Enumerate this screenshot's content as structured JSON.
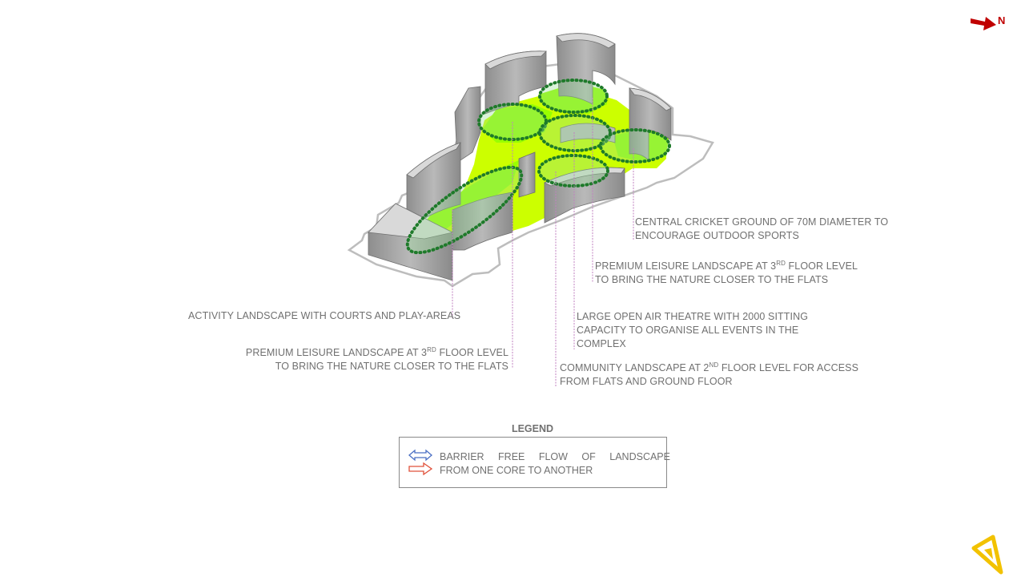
{
  "north": {
    "label": "N",
    "icon": "north-arrow-icon",
    "color": "#c00000"
  },
  "callouts": {
    "cricket_1": "CENTRAL CRICKET GROUND OF 70M DIAMETER TO",
    "cricket_2": "ENCOURAGE OUTDOOR SPORTS",
    "premium_right_1a": "PREMIUM LEISURE LANDSCAPE AT 3",
    "premium_right_1sup": "RD",
    "premium_right_1b": " FLOOR LEVEL",
    "premium_right_2": "TO BRING THE NATURE CLOSER TO THE FLATS",
    "activity": "ACTIVITY LANDSCAPE WITH COURTS AND PLAY-AREAS",
    "theatre_1": "LARGE OPEN AIR THEATRE WITH 2000 SITTING",
    "theatre_2": "CAPACITY TO ORGANISE ALL EVENTS IN THE",
    "theatre_3": "COMPLEX",
    "premium_left_1a": "PREMIUM LEISURE LANDSCAPE AT 3",
    "premium_left_1sup": "RD",
    "premium_left_1b": " FLOOR LEVEL",
    "premium_left_2": "TO BRING THE NATURE CLOSER TO THE FLATS",
    "community_1a": "COMMUNITY LANDSCAPE AT 2",
    "community_1sup": "ND",
    "community_1b": " FLOOR LEVEL FOR ACCESS",
    "community_2": "FROM FLATS AND GROUND FLOOR"
  },
  "legend": {
    "title": "LEGEND",
    "line_1": "BARRIER FREE FLOW OF LANDSCAPE",
    "line_2": "FROM ONE CORE TO ANOTHER",
    "blue_arrow_icon": "double-arrow-icon",
    "red_arrow_icon": "right-arrow-icon",
    "blue_color": "#4a6fc4",
    "red_color": "#e0503a"
  },
  "colors": {
    "landscape": "#ccff00",
    "landscape_bright": "#99ff00",
    "zone_outline": "#1e7a2a",
    "building": "#a6a6a6",
    "leader_line": "#c080c0"
  },
  "logo": {
    "icon": "triangle-logo-icon",
    "color": "#f2c200"
  }
}
